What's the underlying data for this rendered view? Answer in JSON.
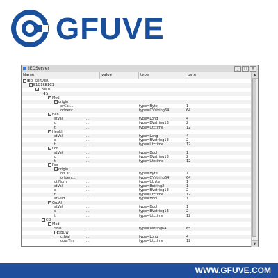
{
  "brand": {
    "name": "GFUVE",
    "url": "WWW.GFUVE.COM",
    "color": "#1a4f9c"
  },
  "window": {
    "title": "IEDServer"
  },
  "columns": {
    "name": "Name",
    "value": "value",
    "type": "type",
    "byte": "byte"
  },
  "rows": [
    {
      "depth": 0,
      "name": "IED_SERVER",
      "value": "",
      "type": "",
      "byte": ""
    },
    {
      "depth": 1,
      "name": "E1Q1SB1C1",
      "value": "",
      "type": "",
      "byte": ""
    },
    {
      "depth": 2,
      "name": "CSWI1",
      "value": "",
      "type": "",
      "byte": ""
    },
    {
      "depth": 3,
      "name": "ST",
      "value": "",
      "type": "",
      "byte": ""
    },
    {
      "depth": 4,
      "name": "Mod",
      "value": "",
      "type": "",
      "byte": ""
    },
    {
      "depth": 5,
      "name": "origin",
      "value": "",
      "type": "",
      "byte": ""
    },
    {
      "depth": 6,
      "name": "orCat...",
      "value": "",
      "type": "type=Byte",
      "byte": "1"
    },
    {
      "depth": 6,
      "name": "orIdent...",
      "value": "",
      "type": "type=OVstring64",
      "byte": "64"
    },
    {
      "depth": 4,
      "name": "Beh",
      "value": "",
      "type": "",
      "byte": ""
    },
    {
      "depth": 5,
      "name": "stVal",
      "value": "...",
      "type": "type=Long",
      "byte": "4"
    },
    {
      "depth": 5,
      "name": "q",
      "value": "...",
      "type": "type=BVstring13",
      "byte": "2"
    },
    {
      "depth": 5,
      "name": "t",
      "value": "...",
      "type": "type=Utctime",
      "byte": "12"
    },
    {
      "depth": 4,
      "name": "Health",
      "value": "",
      "type": "",
      "byte": ""
    },
    {
      "depth": 5,
      "name": "stVal",
      "value": "...",
      "type": "type=Long",
      "byte": "4"
    },
    {
      "depth": 5,
      "name": "q",
      "value": "...",
      "type": "type=BVstring13",
      "byte": "2"
    },
    {
      "depth": 5,
      "name": "t",
      "value": "...",
      "type": "type=Utctime",
      "byte": "12"
    },
    {
      "depth": 4,
      "name": "Loc",
      "value": "",
      "type": "",
      "byte": ""
    },
    {
      "depth": 5,
      "name": "stVal",
      "value": "...",
      "type": "type=Bool",
      "byte": "1"
    },
    {
      "depth": 5,
      "name": "q",
      "value": "...",
      "type": "type=BVstring13",
      "byte": "2"
    },
    {
      "depth": 5,
      "name": "t",
      "value": "...",
      "type": "type=Utctime",
      "byte": "12"
    },
    {
      "depth": 4,
      "name": "Pos",
      "value": "",
      "type": "",
      "byte": ""
    },
    {
      "depth": 5,
      "name": "origin",
      "value": "",
      "type": "",
      "byte": ""
    },
    {
      "depth": 6,
      "name": "orCat...",
      "value": "",
      "type": "type=Byte",
      "byte": "1"
    },
    {
      "depth": 6,
      "name": "orIdent...",
      "value": "",
      "type": "type=OVstring64",
      "byte": "64"
    },
    {
      "depth": 5,
      "name": "ctlNum",
      "value": "...",
      "type": "type=Ubyte",
      "byte": "1"
    },
    {
      "depth": 5,
      "name": "stVal",
      "value": "...",
      "type": "type=Bstring2",
      "byte": "1"
    },
    {
      "depth": 5,
      "name": "q",
      "value": "...",
      "type": "type=BVstring13",
      "byte": "2"
    },
    {
      "depth": 5,
      "name": "t",
      "value": "...",
      "type": "type=Utctime",
      "byte": "12"
    },
    {
      "depth": 5,
      "name": "stSeld",
      "value": "...",
      "type": "type=Bool",
      "byte": "1"
    },
    {
      "depth": 4,
      "name": "GrpAl",
      "value": "",
      "type": "",
      "byte": ""
    },
    {
      "depth": 5,
      "name": "stVal",
      "value": "...",
      "type": "type=Bool",
      "byte": "1"
    },
    {
      "depth": 5,
      "name": "q",
      "value": "...",
      "type": "type=BVstring13",
      "byte": "2"
    },
    {
      "depth": 5,
      "name": "t",
      "value": "...",
      "type": "type=Utctime",
      "byte": "12"
    },
    {
      "depth": 3,
      "name": "CO",
      "value": "",
      "type": "",
      "byte": ""
    },
    {
      "depth": 4,
      "name": "Mod",
      "value": "",
      "type": "",
      "byte": ""
    },
    {
      "depth": 5,
      "name": "SBO",
      "value": "...",
      "type": "type=Vstring64",
      "byte": "65"
    },
    {
      "depth": 5,
      "name": "SBOw",
      "value": "",
      "type": "",
      "byte": ""
    },
    {
      "depth": 6,
      "name": "ctlVal",
      "value": "...",
      "type": "type=Long",
      "byte": "4"
    },
    {
      "depth": 6,
      "name": "operTm",
      "value": "...",
      "type": "type=Utctime",
      "byte": "12"
    }
  ]
}
